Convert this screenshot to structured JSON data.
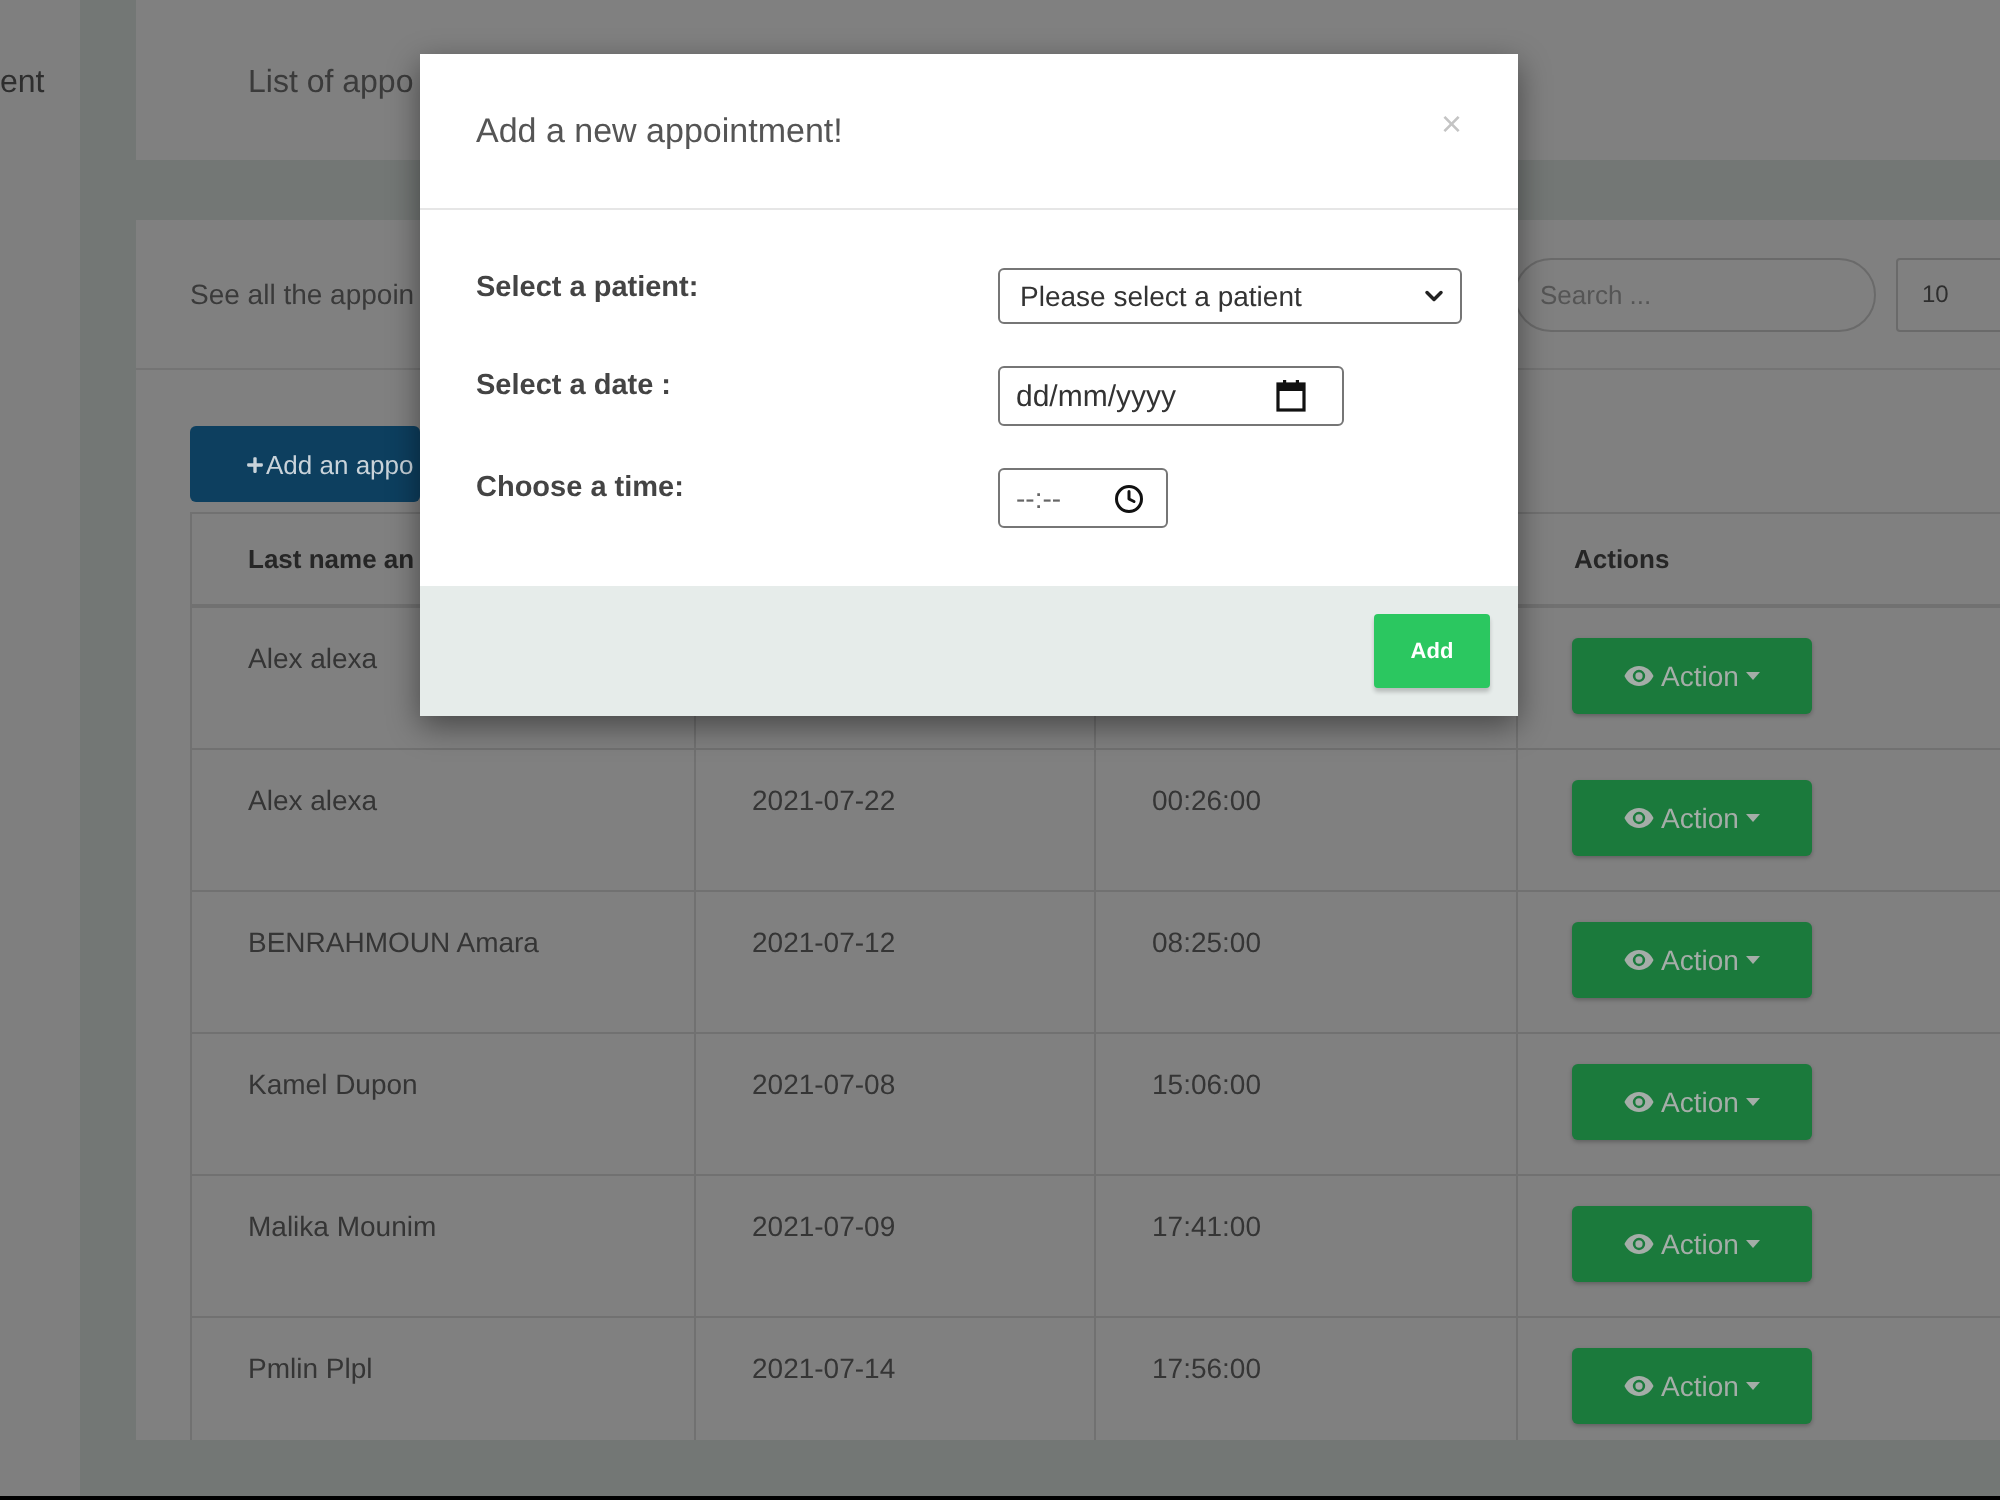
{
  "sidebar": {
    "item": "ent"
  },
  "page_header": {
    "title": "List of appo"
  },
  "appointments": {
    "subtitle": "See all the appoin",
    "search": {
      "placeholder": "Search ..."
    },
    "page_size": "10",
    "add_button": "Add an appo"
  },
  "table": {
    "column_headers": {
      "column_1": "Last name an",
      "column_4": "Actions"
    },
    "rows": [
      {
        "name": "Alex alexa",
        "action": "Action"
      },
      {
        "name": "Alex alexa",
        "date": "2021-07-22",
        "time": "00:26:00",
        "action": "Action"
      },
      {
        "name": "BENRAHMOUN Amara",
        "date": "2021-07-12",
        "time": "08:25:00",
        "action": "Action"
      },
      {
        "name": "Kamel Dupon",
        "date": "2021-07-08",
        "time": "15:06:00",
        "action": "Action"
      },
      {
        "name": "Malika Mounim",
        "date": "2021-07-09",
        "time": "17:41:00",
        "action": "Action"
      },
      {
        "name": "Pmlin Plpl",
        "date": "2021-07-14",
        "time": "17:56:00",
        "action": "Action"
      }
    ]
  },
  "modal": {
    "title": "Add a new appointment!",
    "close": "×",
    "fields": [
      {
        "kind": "select",
        "label": "Select a patient:",
        "value": "Please select a patient"
      },
      {
        "kind": "date",
        "label": "Select a date :",
        "placeholder": "dd/mm/yyyy"
      },
      {
        "kind": "time",
        "label": "Choose a time:",
        "placeholder": "--:--"
      }
    ],
    "submit": "Add"
  }
}
